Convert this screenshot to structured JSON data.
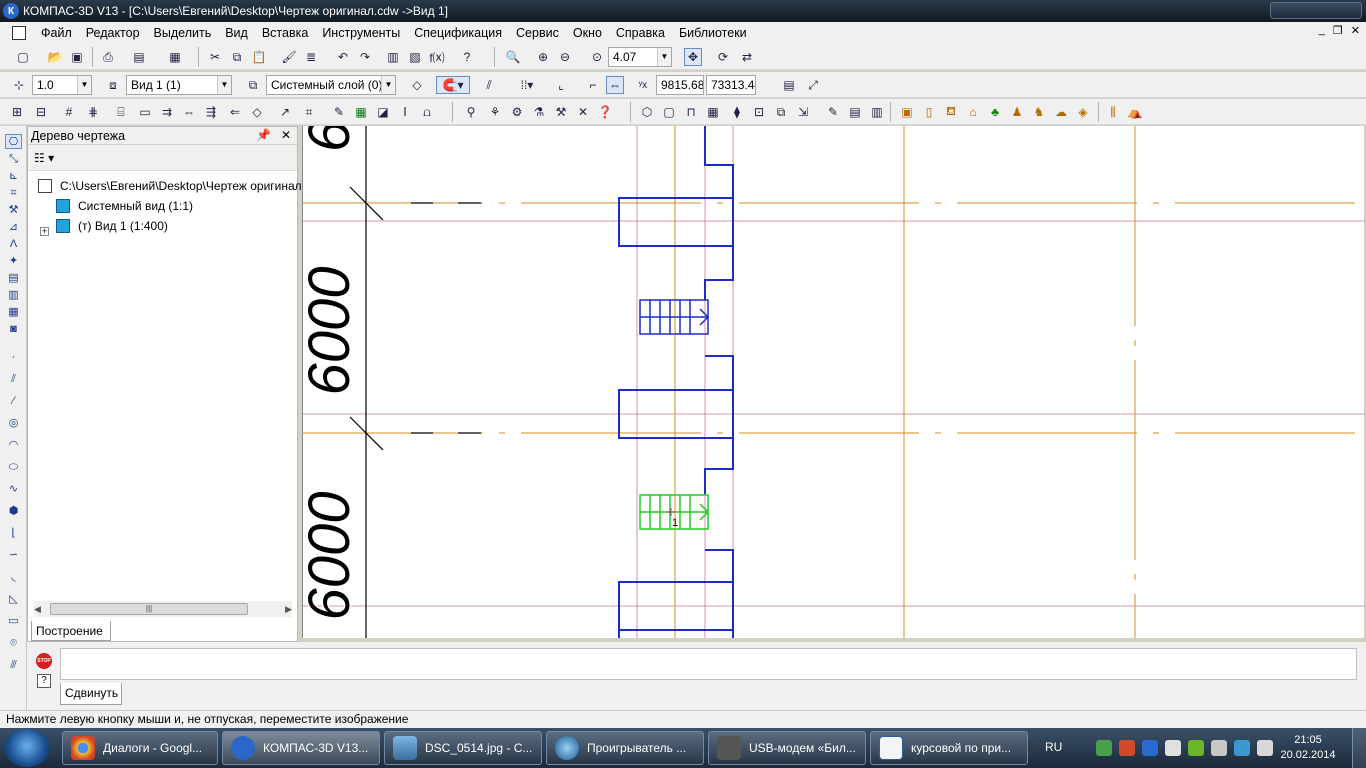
{
  "window": {
    "title": "КОМПАС-3D V13 - [C:\\Users\\Евгений\\Desktop\\Чертеж оригинал.cdw ->Вид 1]"
  },
  "menu": {
    "items": [
      "Файл",
      "Редактор",
      "Выделить",
      "Вид",
      "Вставка",
      "Инструменты",
      "Спецификация",
      "Сервис",
      "Окно",
      "Справка",
      "Библиотеки"
    ]
  },
  "toolbar_standard": {
    "zoom_value": "4.07"
  },
  "toolbar_current_state": {
    "step_value": "1.0",
    "view_value": "Вид 1 (1)",
    "layer_value": "Системный слой (0)",
    "coord_x": "9815.68",
    "coord_y": "73313.44"
  },
  "tree_panel": {
    "title": "Дерево чертежа",
    "root_label": "C:\\Users\\Евгений\\Desktop\\Чертеж оригинал",
    "items": [
      {
        "label": "Системный вид (1:1)"
      },
      {
        "label": "(т) Вид 1 (1:400)"
      }
    ],
    "bottom_tab": "Построение"
  },
  "drawing": {
    "dimension_texts": [
      "6000",
      "6000",
      "6"
    ],
    "marker_label": "1"
  },
  "command_panel": {
    "tab_label": "Сдвинуть"
  },
  "status_bar": {
    "message": "Нажмите левую кнопку мыши и, не отпуская, переместите изображение"
  },
  "taskbar": {
    "tasks": [
      {
        "label": "Диалоги - Googl..."
      },
      {
        "label": "КОМПАС-3D V13..."
      },
      {
        "label": "DSC_0514.jpg - C..."
      },
      {
        "label": "Проигрыватель ..."
      },
      {
        "label": "USB-модем «Бил..."
      },
      {
        "label": "курсовой по при..."
      }
    ],
    "language": "RU",
    "clock_time": "21:05",
    "clock_date": "20.02.2014"
  },
  "colors": {
    "axis_line": "#d98c1a",
    "thin_line": "#c4789a",
    "geometry": "#1c2ec2",
    "selected": "#22cc22",
    "text_black": "#000000"
  }
}
